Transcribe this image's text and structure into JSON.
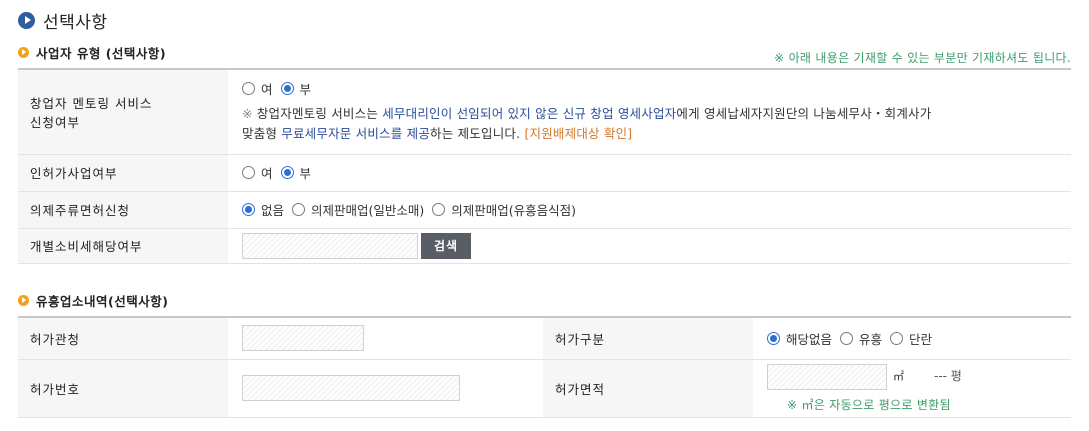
{
  "page_title": "선택사항",
  "section1": {
    "heading": "사업자 유형 (선택사항)",
    "note": "※ 아래 내용은 기재할 수 있는 부분만 기재하셔도 됩니다.",
    "rows": {
      "mentoring": {
        "label_line1": "창업자 멘토링 서비스",
        "label_line2": "신청여부",
        "options": [
          "여",
          "부"
        ],
        "selected": "부",
        "desc_prefix": "※ ",
        "desc_a": "창업자멘토링 서비스는 ",
        "desc_b": "세무대리인이 선임되어 있지 않은 신규 창업 영세사업자",
        "desc_c": "에게 영세납세자지원단의 나눔세무사・회계사가",
        "desc_d": "맞춤형 ",
        "desc_e": "무료세무자문 서비스를 제공",
        "desc_f": "하는 제도입니다. ",
        "desc_g": "[지원배제대상 확인]"
      },
      "license": {
        "label": "인허가사업여부",
        "options": [
          "여",
          "부"
        ],
        "selected": "부"
      },
      "liquor": {
        "label": "의제주류면허신청",
        "options": [
          "없음",
          "의제판매업(일반소매)",
          "의제판매업(유흥음식점)"
        ],
        "selected": "없음"
      },
      "excise": {
        "label": "개별소비세해당여부",
        "search_label": "검색"
      }
    }
  },
  "section2": {
    "heading": "유흥업소내역(선택사항)",
    "rows": {
      "authority_label": "허가관청",
      "category_label": "허가구분",
      "category_options": [
        "해당없음",
        "유흥",
        "단란"
      ],
      "category_selected": "해당없음",
      "number_label": "허가번호",
      "area_label": "허가면적",
      "area_unit": "㎡",
      "pyeong_text": "--- 평",
      "conversion_note": "※ ㎡은 자동으로 평으로 변환됨"
    }
  },
  "colors": {
    "accent_blue": "#2e5e9e",
    "section_orange": "#f2a21a",
    "note_green": "#3c9c6c",
    "radio_blue": "#2b6fd6",
    "button_gray": "#595e66"
  }
}
